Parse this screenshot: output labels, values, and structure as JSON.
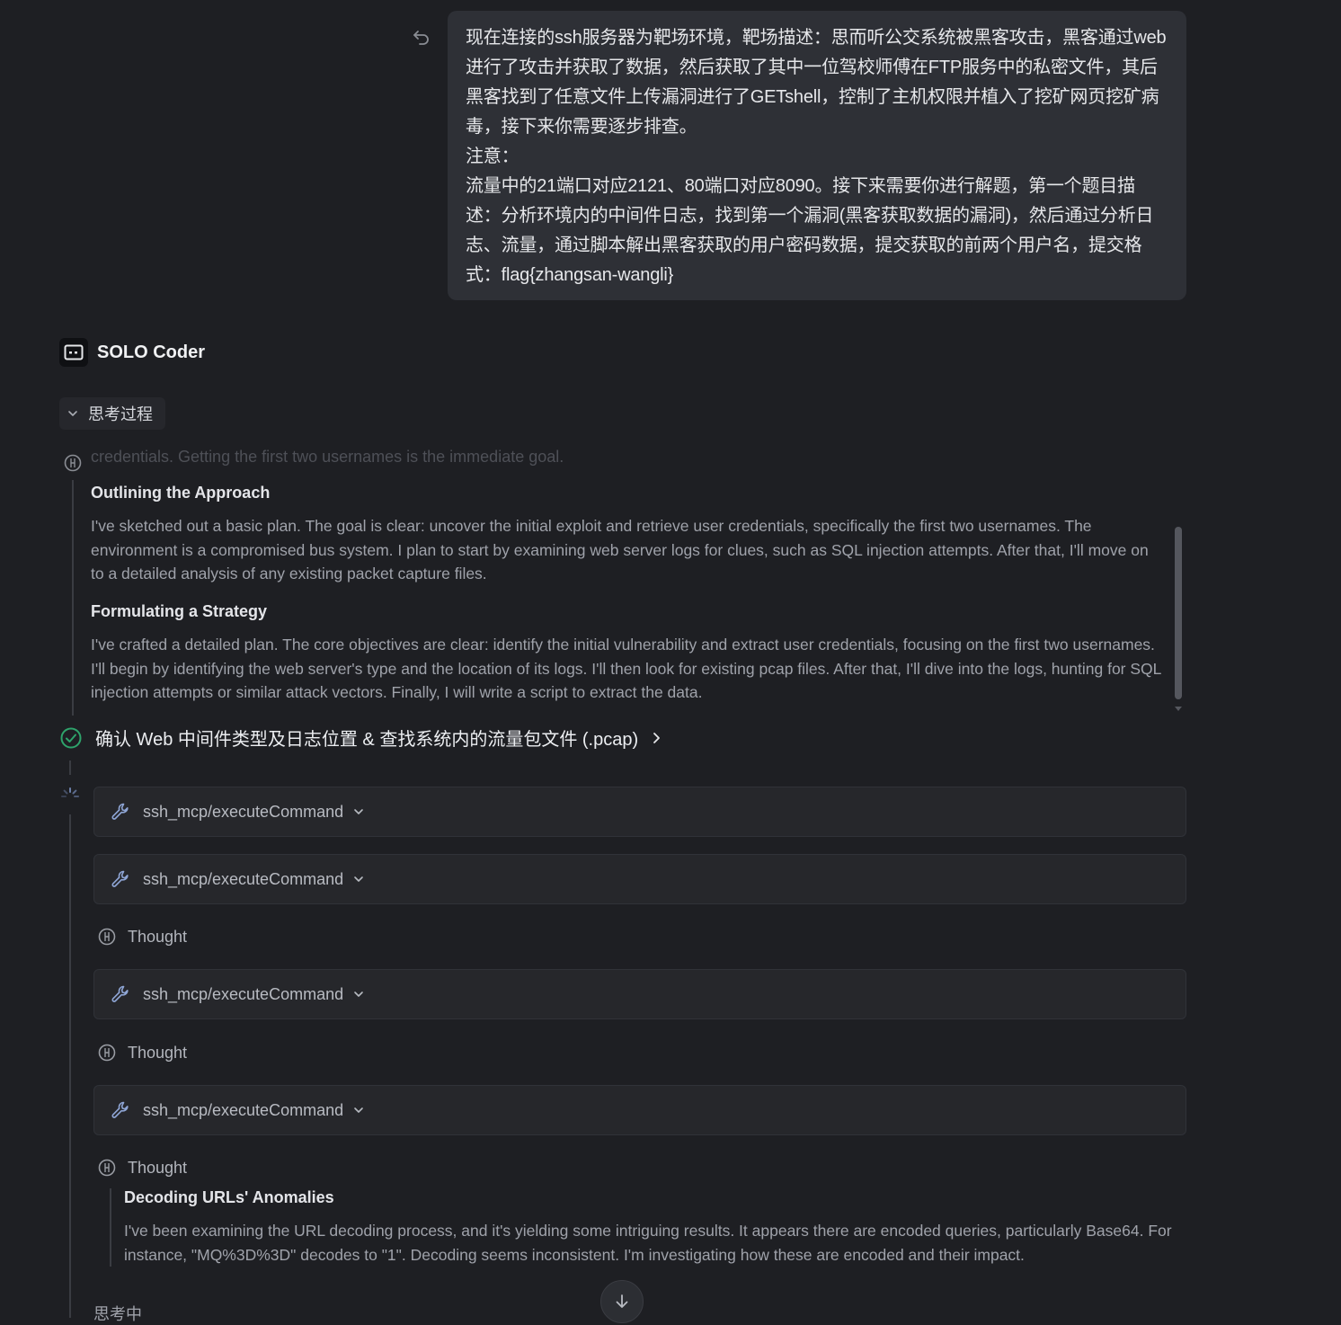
{
  "user_message": {
    "text": "现在连接的ssh服务器为靶场环境，靶场描述：思而听公交系统被黑客攻击，黑客通过web进行了攻击并获取了数据，然后获取了其中一位驾校师傅在FTP服务中的私密文件，其后黑客找到了任意文件上传漏洞进行了GETshell，控制了主机权限并植入了挖矿网页挖矿病毒，接下来你需要逐步排查。\n注意：\n流量中的21端口对应2121、80端口对应8090。接下来需要你进行解题，第一个题目描述：分析环境内的中间件日志，找到第一个漏洞(黑客获取数据的漏洞)，然后通过分析日志、流量，通过脚本解出黑客获取的用户密码数据，提交获取的前两个用户名，提交格式：flag{zhangsan-wangli}"
  },
  "agent": {
    "name": "SOLO Coder"
  },
  "thinking_toggle": {
    "label": "思考过程"
  },
  "thinking": {
    "faded_line": "credentials. Getting the first two usernames is the immediate goal.",
    "sections": [
      {
        "title": "Outlining the Approach",
        "body": "I've sketched out a basic plan. The goal is clear: uncover the initial exploit and retrieve user credentials, specifically the first two usernames. The environment is a compromised bus system. I plan to start by examining web server logs for clues, such as SQL injection attempts. After that, I'll move on to a detailed analysis of any existing packet capture files."
      },
      {
        "title": "Formulating a Strategy",
        "body": "I've crafted a detailed plan. The core objectives are clear: identify the initial vulnerability and extract user credentials, focusing on the first two usernames. I'll begin by identifying the web server's type and the location of its logs. I'll then look for existing pcap files. After that, I'll dive into the logs, hunting for SQL injection attempts or similar attack vectors. Finally, I will write a script to extract the data."
      }
    ]
  },
  "task": {
    "label": "确认 Web 中间件类型及日志位置 & 查找系统内的流量包文件 (.pcap)"
  },
  "steps": {
    "tool_label": "ssh_mcp/executeCommand",
    "thought_label": "Thought"
  },
  "last_thought": {
    "title": "Decoding URLs' Anomalies",
    "body": "I've been examining the URL decoding process, and it's yielding some intriguing results. It appears there are encoded queries, particularly Base64. For instance, \"MQ%3D%3D\" decodes to \"1\". Decoding seems inconsistent. I'm investigating how these are encoded and their impact."
  },
  "status": {
    "label": "思考中"
  },
  "colors": {
    "background": "#1e1f23",
    "bubble": "#2e3036",
    "success": "#2ea36b",
    "card": "#26272b"
  },
  "icons": [
    "undo-icon",
    "agent-avatar-icon",
    "chevron-down-icon",
    "thought-icon",
    "check-circle-icon",
    "chevron-right-icon",
    "wrench-icon",
    "spinner-icon",
    "arrow-down-icon"
  ]
}
